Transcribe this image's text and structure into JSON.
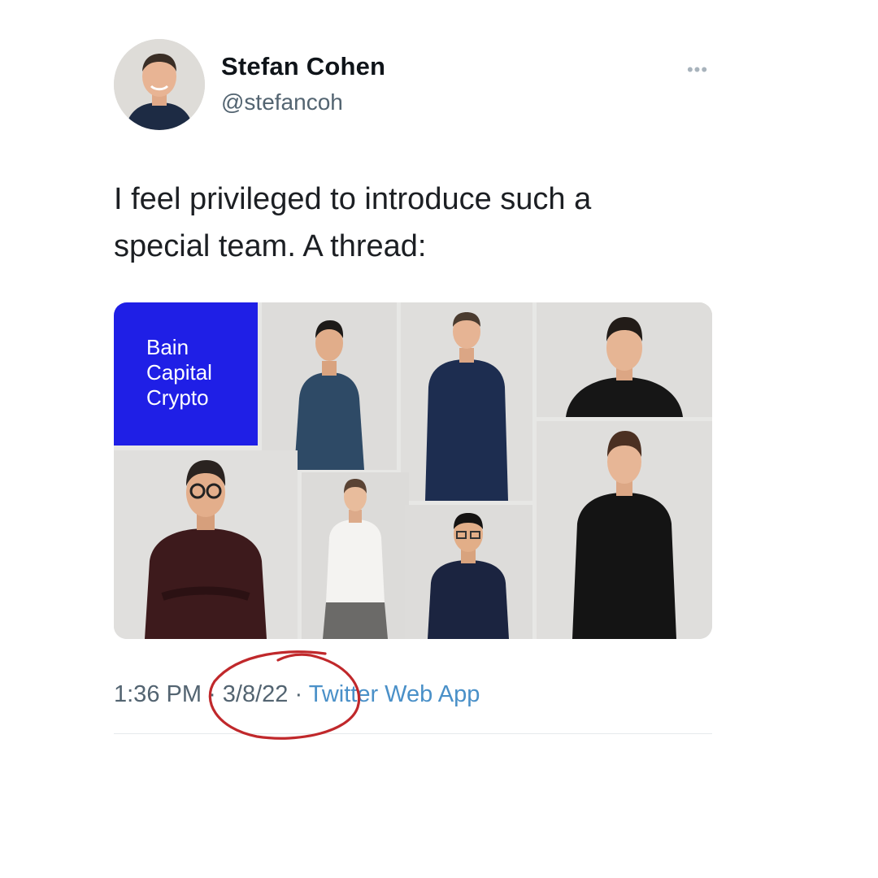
{
  "author": {
    "display_name": "Stefan Cohen",
    "handle": "@stefancoh"
  },
  "more_icon": "more-horizontal-icon",
  "tweet": {
    "text": "I feel privileged to introduce such a\nspecial team. A thread:"
  },
  "media": {
    "logo_lines": [
      "Bain",
      "Capital",
      "Crypto"
    ],
    "logo_color": "#1f1fe6",
    "photo_count": 8
  },
  "meta": {
    "time": "1:36 PM",
    "separator": "·",
    "date": "3/8/22",
    "source": "Twitter Web App"
  },
  "annotation": {
    "color": "#c0282b",
    "icon": "hand-drawn-circle"
  },
  "colors": {
    "text_primary": "#0f1419",
    "text_secondary": "#536471",
    "link": "#4a90c8"
  }
}
